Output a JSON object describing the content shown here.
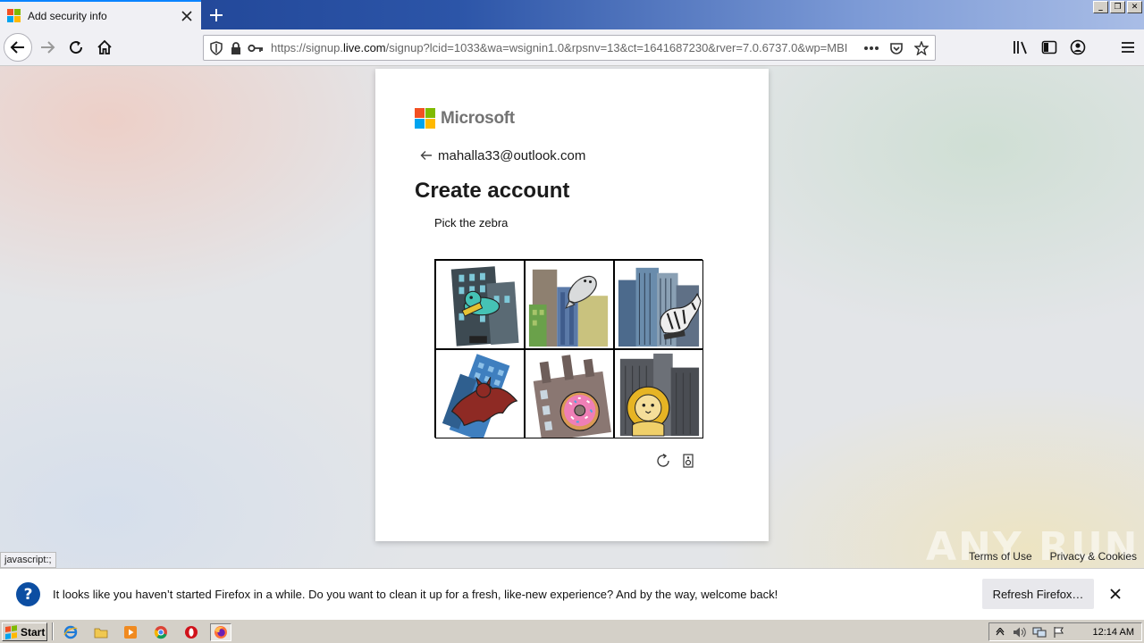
{
  "browser": {
    "tab": {
      "title": "Add security info"
    },
    "url": {
      "prefix": "https://signup.",
      "domain": "live.com",
      "rest": "/signup?lcid=1033&wa=wsignin1.0&rpsnv=13&ct=1641687230&rver=7.0.6737.0&wp=MBI"
    },
    "window_buttons": {
      "minimize": "_",
      "restore": "❐",
      "close": "✕"
    }
  },
  "signup": {
    "brand": "Microsoft",
    "brand_colors": [
      "#f25022",
      "#7fba00",
      "#00a4ef",
      "#ffb900"
    ],
    "email": "mahalla33@outlook.com",
    "title": "Create account",
    "captcha": {
      "prompt": "Pick the zebra",
      "tiles": [
        {
          "subject": "dinosaur"
        },
        {
          "subject": "seal"
        },
        {
          "subject": "zebra"
        },
        {
          "subject": "bat"
        },
        {
          "subject": "donut"
        },
        {
          "subject": "lion"
        }
      ]
    }
  },
  "footer": {
    "terms": "Terms of Use",
    "privacy": "Privacy & Cookies",
    "watermark": "ANY RUN"
  },
  "status_tooltip": "javascript:;",
  "notification": {
    "icon": "?",
    "text": "It looks like you haven’t started Firefox in a while. Do you want to clean it up for a fresh, like-new experience? And by the way, welcome back!",
    "button": "Refresh Firefox…"
  },
  "taskbar": {
    "start": "Start",
    "clock": "12:14 AM"
  }
}
